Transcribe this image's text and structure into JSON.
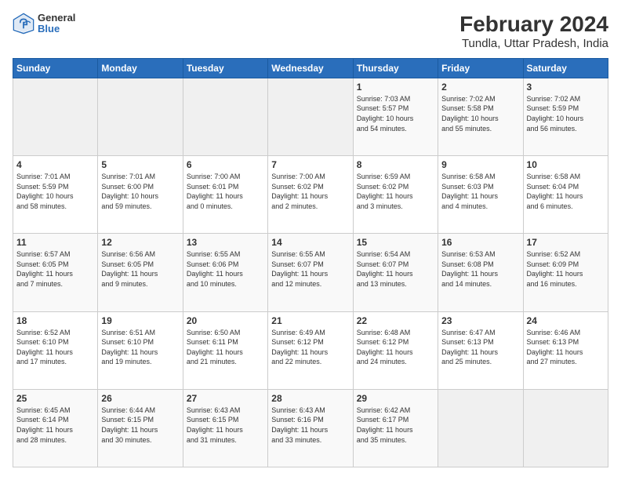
{
  "header": {
    "logo_general": "General",
    "logo_blue": "Blue",
    "title": "February 2024",
    "subtitle": "Tundla, Uttar Pradesh, India"
  },
  "weekdays": [
    "Sunday",
    "Monday",
    "Tuesday",
    "Wednesday",
    "Thursday",
    "Friday",
    "Saturday"
  ],
  "weeks": [
    [
      {
        "day": "",
        "info": ""
      },
      {
        "day": "",
        "info": ""
      },
      {
        "day": "",
        "info": ""
      },
      {
        "day": "",
        "info": ""
      },
      {
        "day": "1",
        "info": "Sunrise: 7:03 AM\nSunset: 5:57 PM\nDaylight: 10 hours\nand 54 minutes."
      },
      {
        "day": "2",
        "info": "Sunrise: 7:02 AM\nSunset: 5:58 PM\nDaylight: 10 hours\nand 55 minutes."
      },
      {
        "day": "3",
        "info": "Sunrise: 7:02 AM\nSunset: 5:59 PM\nDaylight: 10 hours\nand 56 minutes."
      }
    ],
    [
      {
        "day": "4",
        "info": "Sunrise: 7:01 AM\nSunset: 5:59 PM\nDaylight: 10 hours\nand 58 minutes."
      },
      {
        "day": "5",
        "info": "Sunrise: 7:01 AM\nSunset: 6:00 PM\nDaylight: 10 hours\nand 59 minutes."
      },
      {
        "day": "6",
        "info": "Sunrise: 7:00 AM\nSunset: 6:01 PM\nDaylight: 11 hours\nand 0 minutes."
      },
      {
        "day": "7",
        "info": "Sunrise: 7:00 AM\nSunset: 6:02 PM\nDaylight: 11 hours\nand 2 minutes."
      },
      {
        "day": "8",
        "info": "Sunrise: 6:59 AM\nSunset: 6:02 PM\nDaylight: 11 hours\nand 3 minutes."
      },
      {
        "day": "9",
        "info": "Sunrise: 6:58 AM\nSunset: 6:03 PM\nDaylight: 11 hours\nand 4 minutes."
      },
      {
        "day": "10",
        "info": "Sunrise: 6:58 AM\nSunset: 6:04 PM\nDaylight: 11 hours\nand 6 minutes."
      }
    ],
    [
      {
        "day": "11",
        "info": "Sunrise: 6:57 AM\nSunset: 6:05 PM\nDaylight: 11 hours\nand 7 minutes."
      },
      {
        "day": "12",
        "info": "Sunrise: 6:56 AM\nSunset: 6:05 PM\nDaylight: 11 hours\nand 9 minutes."
      },
      {
        "day": "13",
        "info": "Sunrise: 6:55 AM\nSunset: 6:06 PM\nDaylight: 11 hours\nand 10 minutes."
      },
      {
        "day": "14",
        "info": "Sunrise: 6:55 AM\nSunset: 6:07 PM\nDaylight: 11 hours\nand 12 minutes."
      },
      {
        "day": "15",
        "info": "Sunrise: 6:54 AM\nSunset: 6:07 PM\nDaylight: 11 hours\nand 13 minutes."
      },
      {
        "day": "16",
        "info": "Sunrise: 6:53 AM\nSunset: 6:08 PM\nDaylight: 11 hours\nand 14 minutes."
      },
      {
        "day": "17",
        "info": "Sunrise: 6:52 AM\nSunset: 6:09 PM\nDaylight: 11 hours\nand 16 minutes."
      }
    ],
    [
      {
        "day": "18",
        "info": "Sunrise: 6:52 AM\nSunset: 6:10 PM\nDaylight: 11 hours\nand 17 minutes."
      },
      {
        "day": "19",
        "info": "Sunrise: 6:51 AM\nSunset: 6:10 PM\nDaylight: 11 hours\nand 19 minutes."
      },
      {
        "day": "20",
        "info": "Sunrise: 6:50 AM\nSunset: 6:11 PM\nDaylight: 11 hours\nand 21 minutes."
      },
      {
        "day": "21",
        "info": "Sunrise: 6:49 AM\nSunset: 6:12 PM\nDaylight: 11 hours\nand 22 minutes."
      },
      {
        "day": "22",
        "info": "Sunrise: 6:48 AM\nSunset: 6:12 PM\nDaylight: 11 hours\nand 24 minutes."
      },
      {
        "day": "23",
        "info": "Sunrise: 6:47 AM\nSunset: 6:13 PM\nDaylight: 11 hours\nand 25 minutes."
      },
      {
        "day": "24",
        "info": "Sunrise: 6:46 AM\nSunset: 6:13 PM\nDaylight: 11 hours\nand 27 minutes."
      }
    ],
    [
      {
        "day": "25",
        "info": "Sunrise: 6:45 AM\nSunset: 6:14 PM\nDaylight: 11 hours\nand 28 minutes."
      },
      {
        "day": "26",
        "info": "Sunrise: 6:44 AM\nSunset: 6:15 PM\nDaylight: 11 hours\nand 30 minutes."
      },
      {
        "day": "27",
        "info": "Sunrise: 6:43 AM\nSunset: 6:15 PM\nDaylight: 11 hours\nand 31 minutes."
      },
      {
        "day": "28",
        "info": "Sunrise: 6:43 AM\nSunset: 6:16 PM\nDaylight: 11 hours\nand 33 minutes."
      },
      {
        "day": "29",
        "info": "Sunrise: 6:42 AM\nSunset: 6:17 PM\nDaylight: 11 hours\nand 35 minutes."
      },
      {
        "day": "",
        "info": ""
      },
      {
        "day": "",
        "info": ""
      }
    ]
  ]
}
